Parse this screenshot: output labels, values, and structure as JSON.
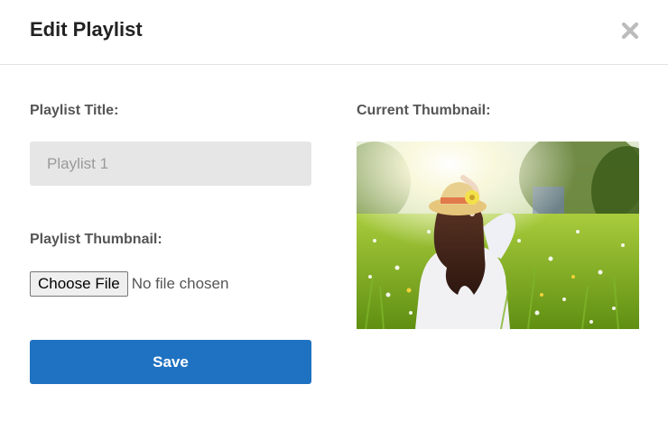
{
  "modal": {
    "title": "Edit Playlist",
    "close_icon": "close-icon"
  },
  "form": {
    "title_label": "Playlist Title:",
    "title_value": "Playlist 1",
    "thumbnail_label": "Playlist Thumbnail:",
    "choose_file_label": "Choose File",
    "file_status": "No file chosen",
    "save_label": "Save"
  },
  "preview": {
    "label": "Current Thumbnail:",
    "image": "woman-in-hat-in-meadow-photo"
  },
  "colors": {
    "primary": "#1f72c1",
    "input_bg": "#e6e6e6",
    "label_text": "#555555"
  }
}
